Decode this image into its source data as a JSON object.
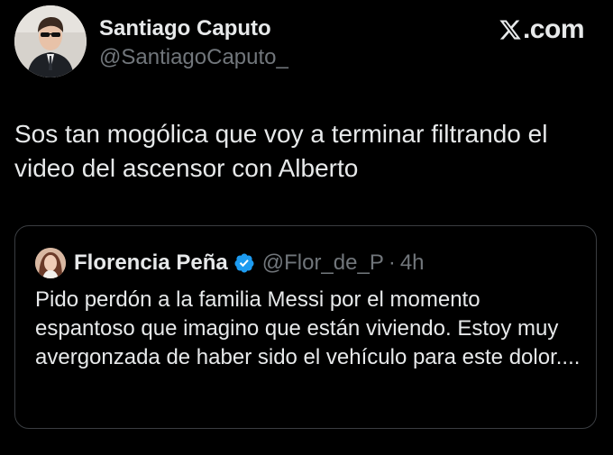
{
  "author": {
    "name": "Santiago Caputo",
    "handle": "@SantiagoCaputo_"
  },
  "brand": {
    "label": ".com"
  },
  "tweet": {
    "text": "Sos tan mogólica que voy a terminar filtrando el video del ascensor con Alberto"
  },
  "quote": {
    "name": "Florencia Peña",
    "handle": "@Flor_de_P",
    "dot": "·",
    "time": "4h",
    "text": "Pido perdón a la familia Messi por el momento espantoso que imagino que están viviendo. Estoy muy avergonzada de haber sido el vehículo para este dolor...."
  },
  "colors": {
    "background": "#000000",
    "text": "#e7e9ea",
    "muted": "#71767b",
    "border": "#3a3d41",
    "verified": "#1d9bf0"
  },
  "icons": {
    "brand": "x-logo-icon",
    "verified": "verified-badge-icon"
  }
}
